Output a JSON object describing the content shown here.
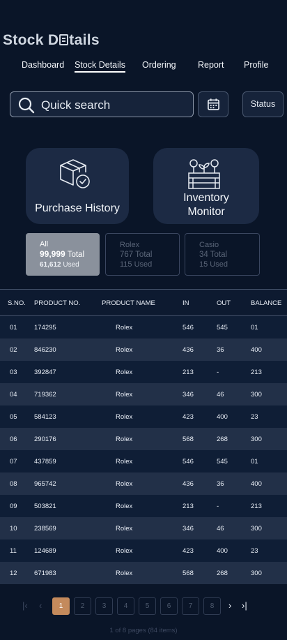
{
  "app": {
    "title_before": "Stock D",
    "title_after": "tails"
  },
  "nav": [
    {
      "label": "Dashboard",
      "active": false
    },
    {
      "label": "Stock Details",
      "active": true
    },
    {
      "label": "Ordering",
      "active": false
    },
    {
      "label": "Report",
      "active": false
    },
    {
      "label": "Profile",
      "active": false
    }
  ],
  "search": {
    "placeholder": "Quick search",
    "icon": "search-icon"
  },
  "calendar": {
    "icon": "calendar-icon"
  },
  "status_button": {
    "label": "Status"
  },
  "cards": {
    "purchase": {
      "label": "Purchase History",
      "icon": "box-check-icon"
    },
    "inventory": {
      "line1": "Inventory",
      "line2": "Monitor",
      "icon": "plant-crate-icon"
    }
  },
  "filters": [
    {
      "name": "All",
      "total_value": "99,999",
      "total_label": "Total",
      "used": "61,612",
      "used_label": "Used",
      "selected": true
    },
    {
      "name": "Rolex",
      "total": "767 Total",
      "used": "115 Used",
      "selected": false
    },
    {
      "name": "Casio",
      "total": "34 Total",
      "used": "15 Used",
      "selected": false
    }
  ],
  "table": {
    "headers": [
      "S.NO.",
      "PRODUCT NO.",
      "PRODUCT NAME",
      "IN",
      "OUT",
      "BALANCE"
    ],
    "rows": [
      [
        "01",
        "174295",
        "Rolex",
        "546",
        "545",
        "01"
      ],
      [
        "02",
        "846230",
        "Rolex",
        "436",
        "36",
        "400"
      ],
      [
        "03",
        "392847",
        "Rolex",
        "213",
        "-",
        "213"
      ],
      [
        "04",
        "719362",
        "Rolex",
        "346",
        "46",
        "300"
      ],
      [
        "05",
        "584123",
        "Rolex",
        "423",
        "400",
        "23"
      ],
      [
        "06",
        "290176",
        "Rolex",
        "568",
        "268",
        "300"
      ],
      [
        "07",
        "437859",
        "Rolex",
        "546",
        "545",
        "01"
      ],
      [
        "08",
        "965742",
        "Rolex",
        "436",
        "36",
        "400"
      ],
      [
        "09",
        "503821",
        "Rolex",
        "213",
        "-",
        "213"
      ],
      [
        "10",
        "238569",
        "Rolex",
        "346",
        "46",
        "300"
      ],
      [
        "11",
        "124689",
        "Rolex",
        "423",
        "400",
        "23"
      ],
      [
        "12",
        "671983",
        "Rolex",
        "568",
        "268",
        "300"
      ]
    ]
  },
  "pagination": {
    "first": "|‹",
    "prev": "‹",
    "pages": [
      "1",
      "2",
      "3",
      "4",
      "5",
      "6",
      "7",
      "8"
    ],
    "current": "1",
    "next": "›",
    "last": "›|",
    "info": "1 of 8 pages (84 items)"
  },
  "colors": {
    "background": "#0a1528",
    "card": "#1c2a44",
    "accent_page": "#c48a5c",
    "selected_filter": "#8a919c"
  }
}
